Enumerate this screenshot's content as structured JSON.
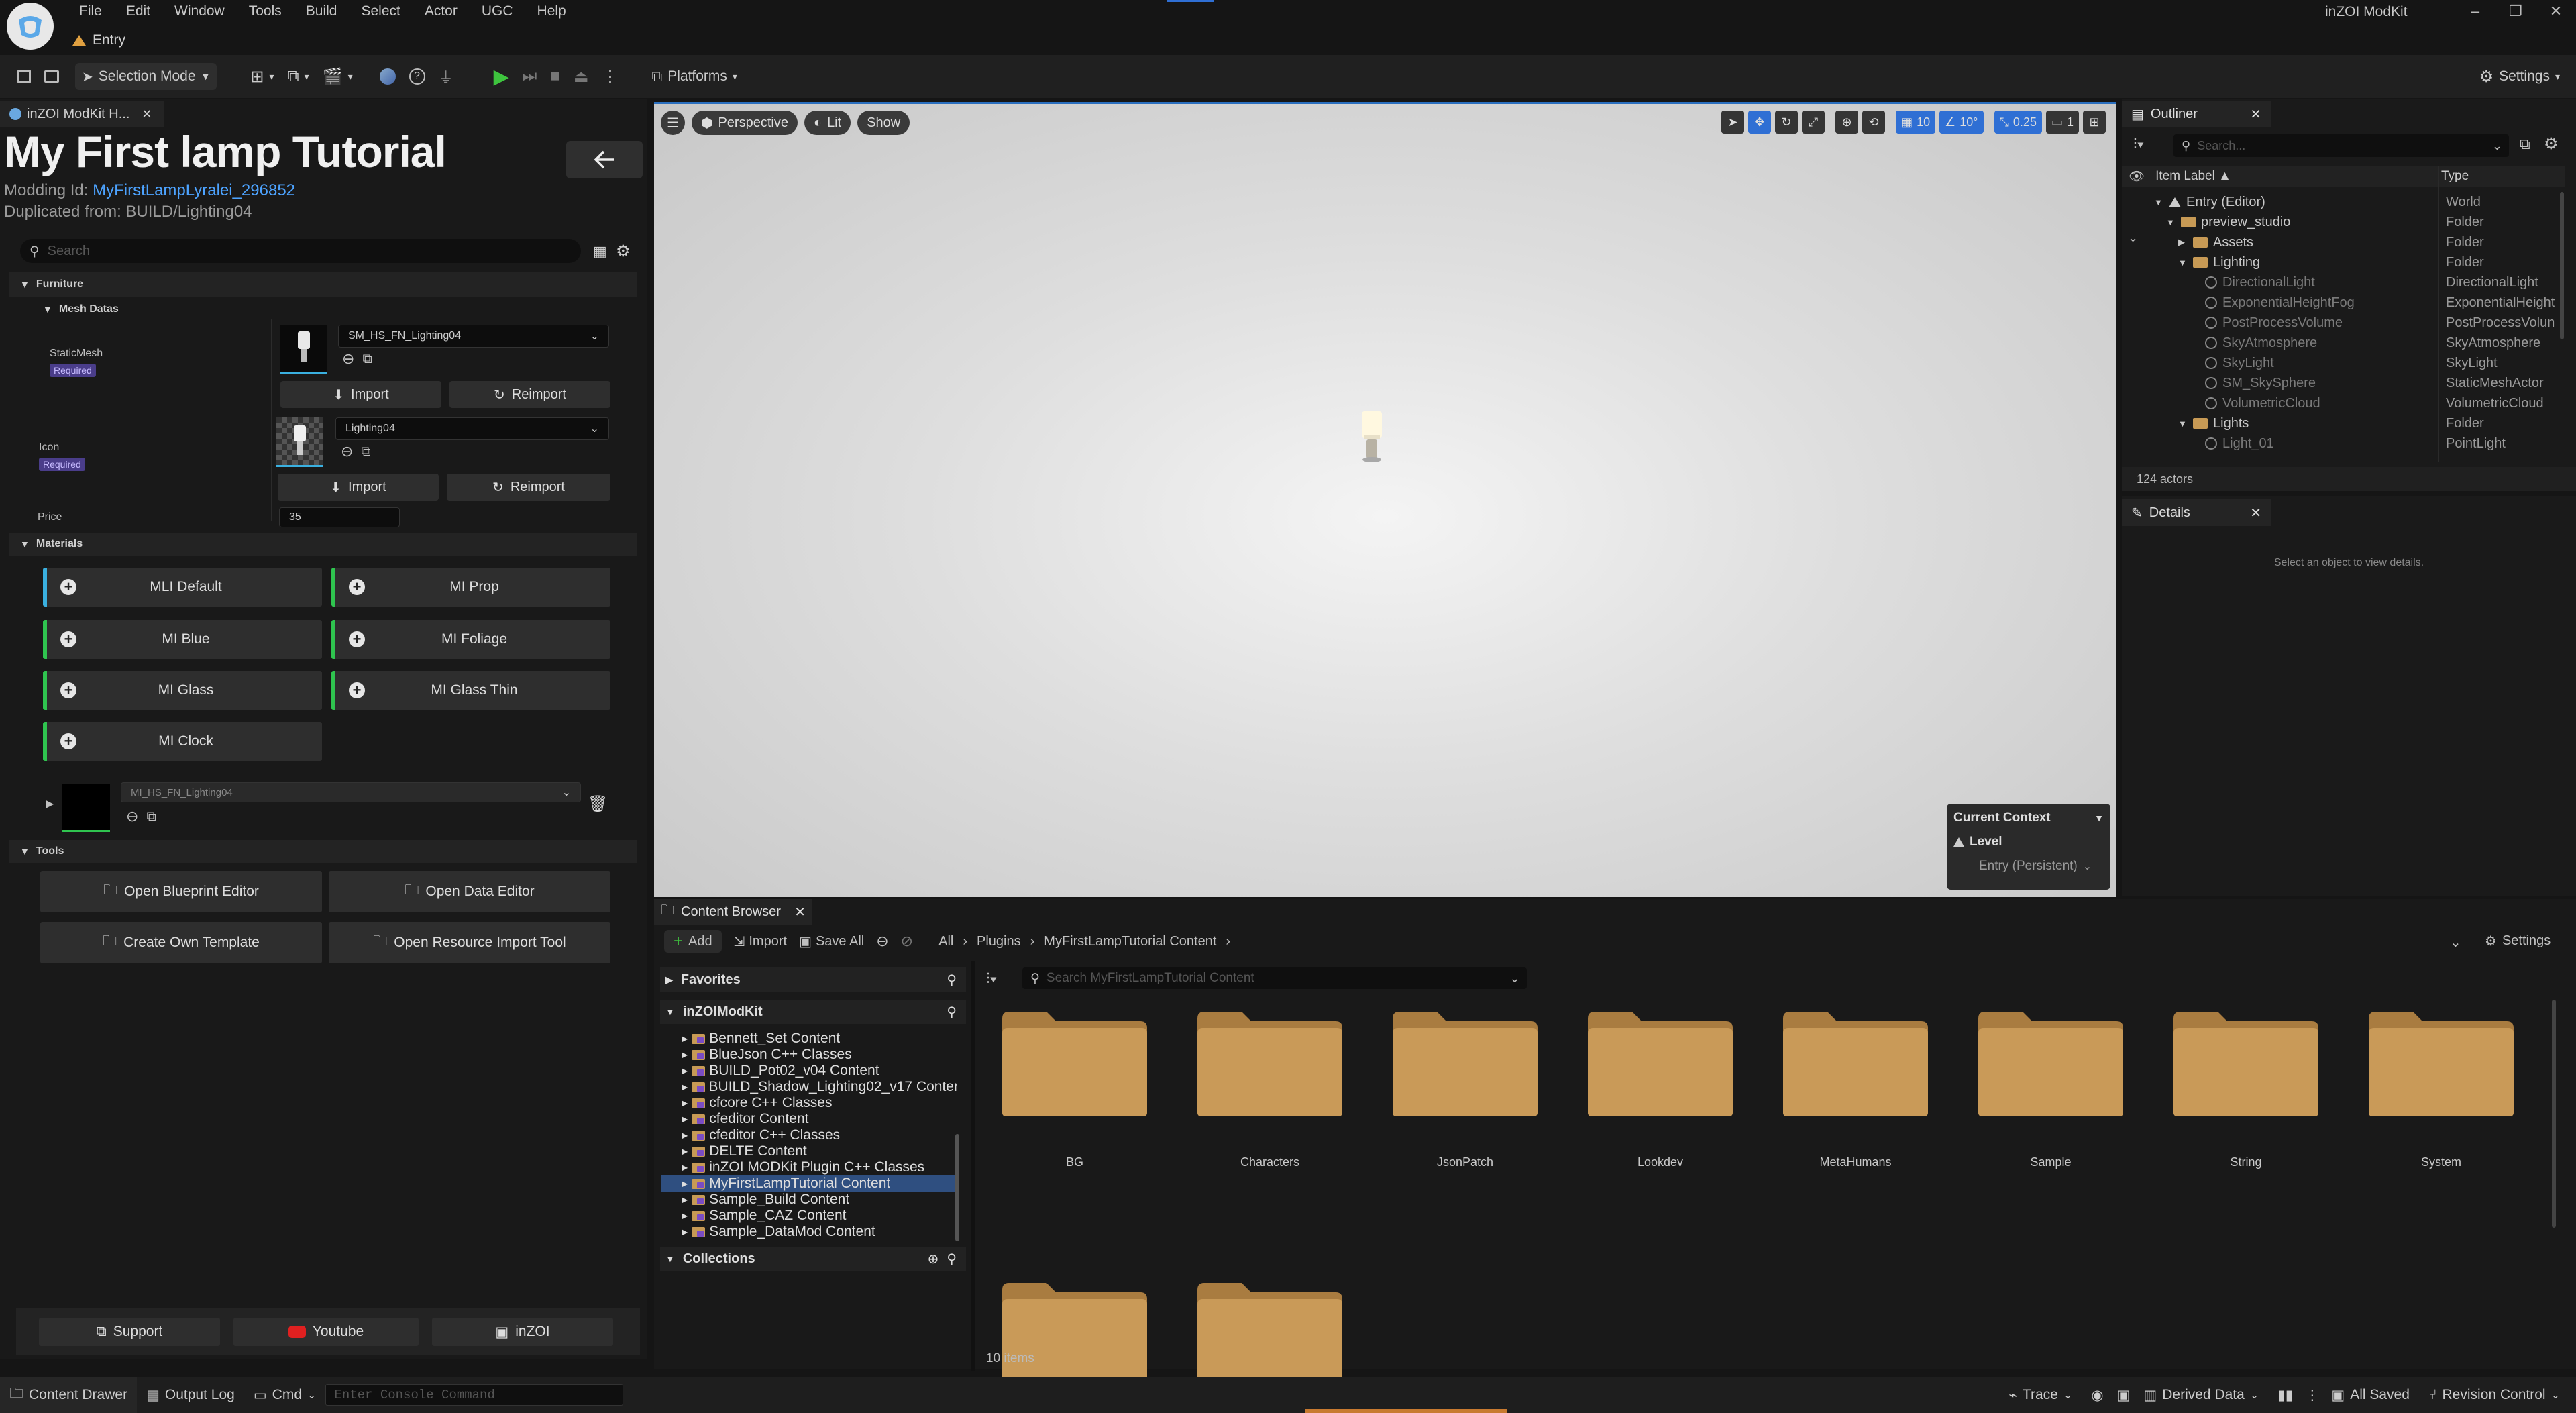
{
  "window": {
    "app_title": "inZOI ModKit",
    "level_tab": "Entry",
    "controls": [
      "–",
      "❐",
      "✕"
    ]
  },
  "menu": [
    "File",
    "Edit",
    "Window",
    "Tools",
    "Build",
    "Select",
    "Actor",
    "UGC",
    "Help"
  ],
  "toolbar": {
    "selection_mode": "Selection Mode",
    "platforms": "Platforms",
    "settings": "Settings"
  },
  "left_panel": {
    "tab_label": "inZOI ModKit H...",
    "title": "My First lamp Tutorial",
    "modding_id_label": "Modding Id:",
    "modding_id_value": "MyFirstLampLyralei_296852",
    "duplicated_from": "Duplicated from: BUILD/Lighting04",
    "search_placeholder": "Search",
    "furniture_header": "Furniture",
    "mesh_datas_header": "Mesh Datas",
    "static_mesh_label": "StaticMesh",
    "required_badge": "Required",
    "static_mesh_value": "SM_HS_FN_Lighting04",
    "icon_label": "Icon",
    "icon_value": "Lighting04",
    "import_label": "Import",
    "reimport_label": "Reimport",
    "price_label": "Price",
    "price_value": "35",
    "materials_header": "Materials",
    "materials": [
      "MLI Default",
      "MI Prop",
      "MI Blue",
      "MI Foliage",
      "MI Glass",
      "MI Glass Thin",
      "MI Clock"
    ],
    "material_slot_value": "MI_HS_FN_Lighting04",
    "tools_header": "Tools",
    "tools": [
      "Open Blueprint Editor",
      "Open Data Editor",
      "Create Own Template",
      "Open Resource Import Tool"
    ],
    "bottom_buttons": [
      "Support",
      "Youtube",
      "inZOI"
    ]
  },
  "viewport": {
    "perspective": "Perspective",
    "lit": "Lit",
    "show": "Show",
    "grid_snap": "10",
    "rot_snap": "10°",
    "scale_snap": "0.25",
    "camera_speed": "1",
    "current_context_title": "Current Context",
    "context_level": "Level",
    "context_value": "Entry (Persistent)"
  },
  "outliner": {
    "tab_label": "Outliner",
    "search_placeholder": "Search...",
    "col_label": "Item Label ▲",
    "col_type": "Type",
    "rows": [
      {
        "label": "Entry (Editor)",
        "type": "World",
        "indent": 0,
        "kind": "world"
      },
      {
        "label": "preview_studio",
        "type": "Folder",
        "indent": 1,
        "kind": "folder"
      },
      {
        "label": "Assets",
        "type": "Folder",
        "indent": 2,
        "kind": "folder"
      },
      {
        "label": "Lighting",
        "type": "Folder",
        "indent": 2,
        "kind": "folder"
      },
      {
        "label": "DirectionalLight",
        "type": "DirectionalLight",
        "indent": 3,
        "kind": "actor"
      },
      {
        "label": "ExponentialHeightFog",
        "type": "ExponentialHeight",
        "indent": 3,
        "kind": "actor"
      },
      {
        "label": "PostProcessVolume",
        "type": "PostProcessVolun",
        "indent": 3,
        "kind": "actor"
      },
      {
        "label": "SkyAtmosphere",
        "type": "SkyAtmosphere",
        "indent": 3,
        "kind": "actor"
      },
      {
        "label": "SkyLight",
        "type": "SkyLight",
        "indent": 3,
        "kind": "actor"
      },
      {
        "label": "SM_SkySphere",
        "type": "StaticMeshActor",
        "indent": 3,
        "kind": "actor"
      },
      {
        "label": "VolumetricCloud",
        "type": "VolumetricCloud",
        "indent": 3,
        "kind": "actor"
      },
      {
        "label": "Lights",
        "type": "Folder",
        "indent": 2,
        "kind": "folder"
      },
      {
        "label": "Light_01",
        "type": "PointLight",
        "indent": 3,
        "kind": "actor"
      }
    ],
    "actor_count": "124 actors"
  },
  "details": {
    "tab_label": "Details",
    "empty_text": "Select an object to view details."
  },
  "content_browser": {
    "tab_label": "Content Browser",
    "add": "Add",
    "import": "Import",
    "save_all": "Save All",
    "breadcrumb": [
      "All",
      "Plugins",
      "MyFirstLampTutorial Content"
    ],
    "settings": "Settings",
    "search_placeholder": "Search MyFirstLampTutorial Content",
    "favorites": "Favorites",
    "root": "inZOIModKit",
    "tree": [
      "Bennett_Set Content",
      "BlueJson C++ Classes",
      "BUILD_Pot02_v04 Content",
      "BUILD_Shadow_Lighting02_v17 Content",
      "cfcore C++ Classes",
      "cfeditor Content",
      "cfeditor C++ Classes",
      "DELTE Content",
      "inZOI MODKit Plugin C++ Classes",
      "MyFirstLampTutorial Content",
      "Sample_Build Content",
      "Sample_CAZ Content",
      "Sample_DataMod Content"
    ],
    "selected_tree_item": "MyFirstLampTutorial Content",
    "collections": "Collections",
    "folders": [
      "BG",
      "Characters",
      "JsonPatch",
      "Lookdev",
      "MetaHumans",
      "Sample",
      "String",
      "System"
    ],
    "item_count": "10 items"
  },
  "statusbar": {
    "content_drawer": "Content Drawer",
    "output_log": "Output Log",
    "cmd": "Cmd",
    "console_placeholder": "Enter Console Command",
    "trace": "Trace",
    "derived_data": "Derived Data",
    "all_saved": "All Saved",
    "revision_control": "Revision Control"
  },
  "colors": {
    "accent_blue": "#2f6fd4",
    "folder": "#c79a55",
    "material_green": "#2fc44f",
    "required_purple": "#4a3d8a",
    "link_blue": "#4da3ff"
  }
}
